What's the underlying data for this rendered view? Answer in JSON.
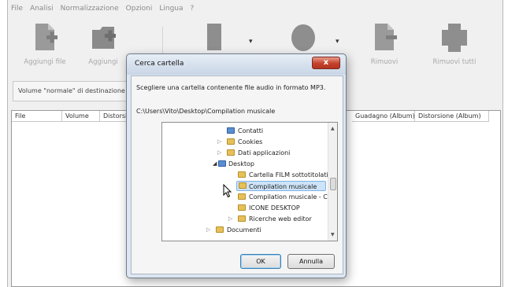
{
  "menu": [
    "File",
    "Analisi",
    "Normalizzazione",
    "Opzioni",
    "Lingua",
    "?"
  ],
  "toolbar": {
    "add_file": "Aggiungi file",
    "add_folder": "Aggiungi",
    "dropdown_arrow": "▾",
    "remove": "Rimuovi",
    "remove_all": "Rimuovi tutti"
  },
  "volume_label": "Volume \"normale\" di destinazione",
  "columns": [
    "File",
    "Volume",
    "Distorsion",
    "Guadagno (Album)",
    "Distorsione (Album)"
  ],
  "dialog": {
    "title": "Cerca cartella",
    "close_symbol": "x",
    "instruction": "Scegliere una cartella contenente file audio in formato MP3.",
    "path": "C:\\Users\\Vito\\Desktop\\Compilation musicale",
    "tree": [
      {
        "label": "Contatti",
        "expander": "",
        "icon": "contacts-folder-icon"
      },
      {
        "label": "Cookies",
        "expander": "▷",
        "icon": "folder-icon"
      },
      {
        "label": "Dati applicazioni",
        "expander": "▷",
        "icon": "folder-icon"
      },
      {
        "label": "Desktop",
        "expander": "◢",
        "icon": "desktop-folder-icon"
      },
      {
        "label": "Cartella FILM sottotitolati",
        "expander": "",
        "icon": "folder-icon"
      },
      {
        "label": "Compilation musicale",
        "expander": "",
        "icon": "folder-icon"
      },
      {
        "label": "Compilation musicale - Copia",
        "expander": "",
        "icon": "folder-icon"
      },
      {
        "label": "ICONE DESKTOP",
        "expander": "",
        "icon": "folder-icon"
      },
      {
        "label": "Ricerche web editor",
        "expander": "▷",
        "icon": "folder-icon"
      },
      {
        "label": "Documenti",
        "expander": "▷",
        "icon": "documents-folder-icon"
      }
    ],
    "selected": "Compilation musicale",
    "ok": "OK",
    "cancel": "Annulla"
  },
  "colors": {
    "dialog_frame": "#dde6f1",
    "close_button": "#c4412c",
    "selection": "#cde3f8",
    "folder": "#e6c15a"
  }
}
